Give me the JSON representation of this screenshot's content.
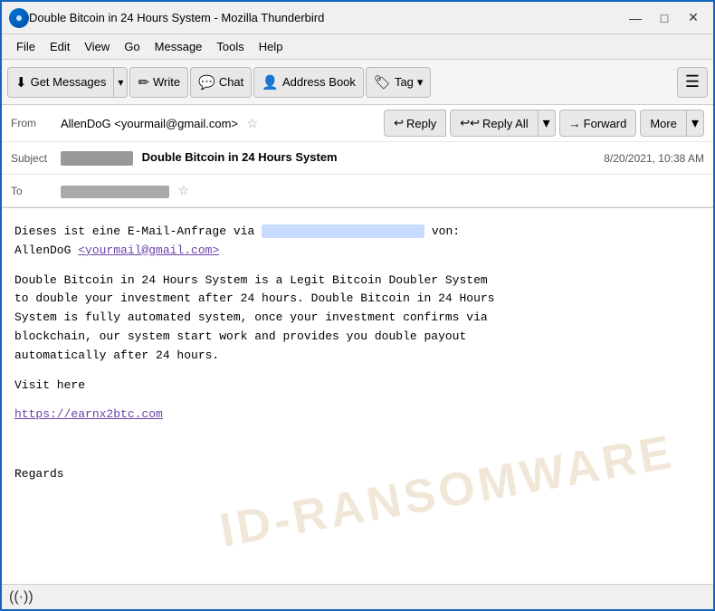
{
  "titleBar": {
    "title": "Double Bitcoin in 24 Hours System - Mozilla Thunderbird",
    "minimize": "—",
    "maximize": "□",
    "close": "✕"
  },
  "menuBar": {
    "items": [
      "File",
      "Edit",
      "View",
      "Go",
      "Message",
      "Tools",
      "Help"
    ]
  },
  "toolbar": {
    "getMessages": "Get Messages",
    "write": "Write",
    "chat": "Chat",
    "addressBook": "Address Book",
    "tag": "Tag",
    "hamMenu": "☰"
  },
  "actionBar": {
    "reply": "↩ Reply",
    "replyAll": "↩↩ Reply All",
    "forward": "→ Forward",
    "more": "More"
  },
  "emailHeader": {
    "fromLabel": "From",
    "fromValue": "AllenDoG <yourmail@gmail.com>",
    "subjectLabel": "Subject",
    "subjectText": "Double Bitcoin in 24 Hours System",
    "dateText": "8/20/2021, 10:38 AM",
    "toLabel": "To"
  },
  "emailBody": {
    "intro": "Dieses ist eine E-Mail-Anfrage via",
    "introEnd": "von:",
    "sender": "AllenDoG",
    "senderEmail": "<yourmail@gmail.com>",
    "paragraph1": "Double Bitcoin in 24 Hours System is a Legit Bitcoin Doubler System\nto double your investment after 24 hours. Double Bitcoin in 24 Hours\nSystem is fully automated system, once your investment confirms via\nblockchain, our system start work and provides you double payout\nautomatically after 24 hours.",
    "visitHere": "Visit here",
    "link": "https://earnx2btc.com",
    "regards": "Regards"
  },
  "statusBar": {
    "wifiSymbol": "((·))"
  }
}
